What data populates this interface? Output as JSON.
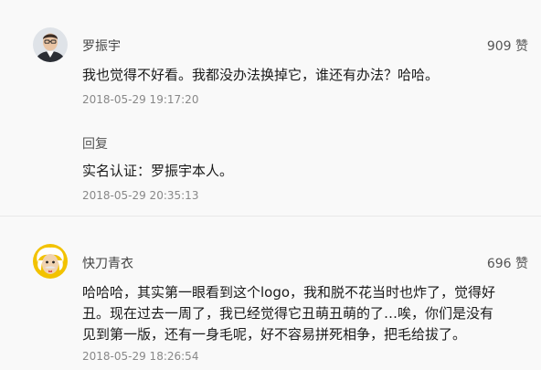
{
  "comments": [
    {
      "username": "罗振宇",
      "likes": "909 赞",
      "text": "我也觉得不好看。我都没办法换掉它，谁还有办法？哈哈。",
      "timestamp": "2018-05-29 19:17:20",
      "reply_label": "回复",
      "reply_text": "实名认证：罗振宇本人。",
      "reply_timestamp": "2018-05-29 20:35:13"
    },
    {
      "username": "快刀青衣",
      "likes": "696 赞",
      "text_lines": [
        "哈哈哈，其实第一眼看到这个logo，我和脱不花当时也炸了，觉得好",
        "丑。现在过去一周了，我已经觉得它丑萌丑萌的了…唉，你们是没有",
        "见到第一版，还有一身毛呢，好不容易拼死相争，把毛给拔了。"
      ],
      "timestamp": "2018-05-29 18:26:54"
    }
  ]
}
